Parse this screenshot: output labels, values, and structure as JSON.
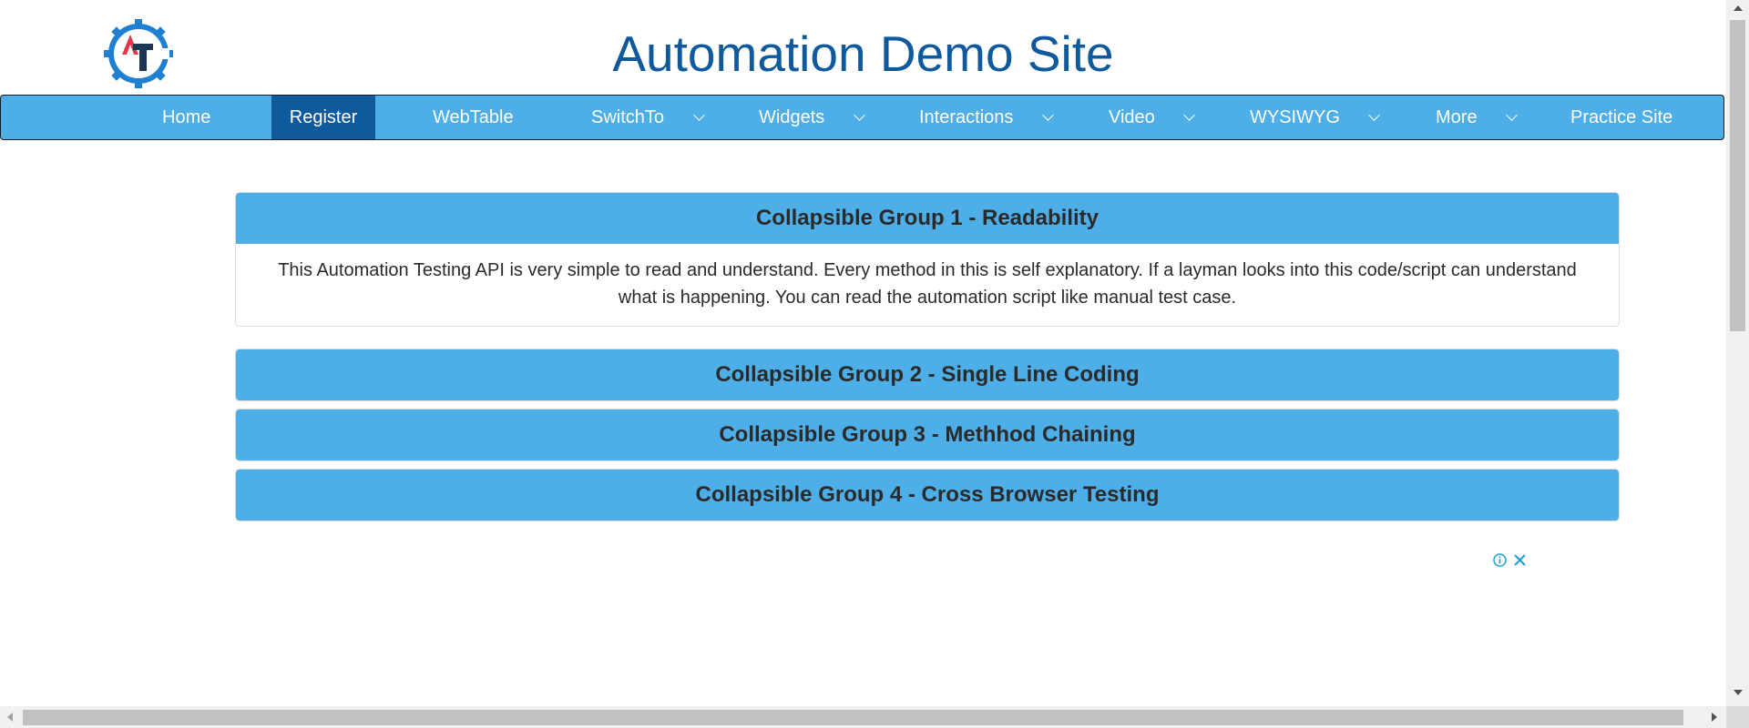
{
  "site": {
    "title": "Automation Demo Site",
    "logo_icon": "gear-at-logo-icon",
    "brand_color": "#0f5a9c",
    "nav_color": "#4daee8"
  },
  "nav": {
    "items": [
      {
        "label": "Home",
        "has_dropdown": false,
        "active": false
      },
      {
        "label": "Register",
        "has_dropdown": false,
        "active": true
      },
      {
        "label": "WebTable",
        "has_dropdown": false,
        "active": false
      },
      {
        "label": "SwitchTo",
        "has_dropdown": true,
        "active": false
      },
      {
        "label": "Widgets",
        "has_dropdown": true,
        "active": false
      },
      {
        "label": "Interactions",
        "has_dropdown": true,
        "active": false
      },
      {
        "label": "Video",
        "has_dropdown": true,
        "active": false
      },
      {
        "label": "WYSIWYG",
        "has_dropdown": true,
        "active": false
      },
      {
        "label": "More",
        "has_dropdown": true,
        "active": false
      },
      {
        "label": "Practice Site",
        "has_dropdown": false,
        "active": false
      }
    ]
  },
  "accordion": {
    "groups": [
      {
        "title": "Collapsible Group 1 - Readability",
        "expanded": true,
        "body": "This Automation Testing API is very simple to read and understand. Every method in this is self explanatory. If a layman looks into this code/script can understand what is happening. You can read the automation script like manual test case."
      },
      {
        "title": "Collapsible Group 2 - Single Line Coding",
        "expanded": false
      },
      {
        "title": "Collapsible Group 3 - Methhod Chaining",
        "expanded": false
      },
      {
        "title": "Collapsible Group 4 - Cross Browser Testing",
        "expanded": false
      }
    ]
  },
  "ad": {
    "info_icon": "info-icon",
    "close_icon": "close-icon",
    "accent_color": "#1aa0d8"
  }
}
